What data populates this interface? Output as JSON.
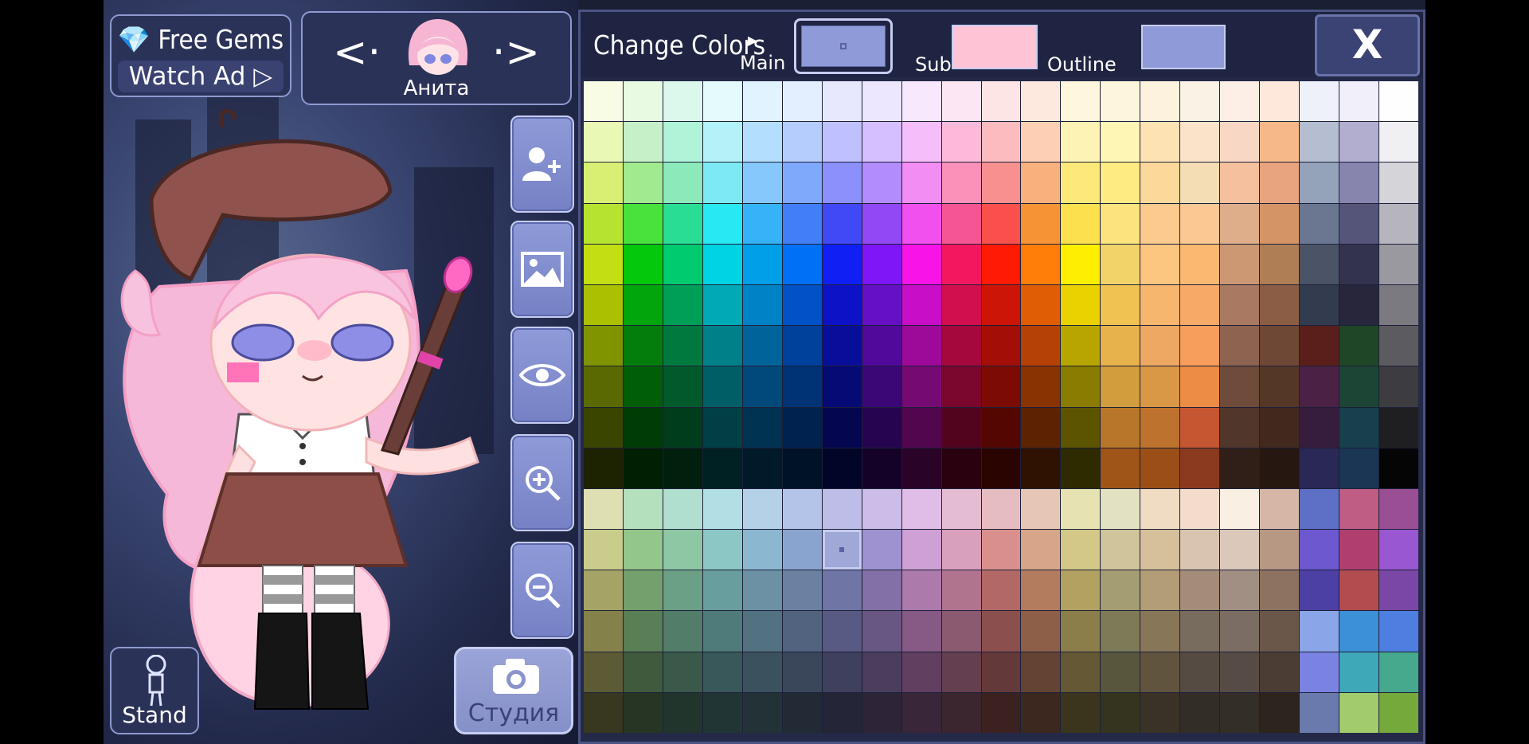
{
  "gems": {
    "line1": "Free Gems",
    "line2": "Watch Ad"
  },
  "character": {
    "name": "Анита"
  },
  "stand": {
    "label": "Stand"
  },
  "studio": {
    "label": "Студия"
  },
  "panel": {
    "title": "Change Colors",
    "main_label": "Main",
    "sub_label": "Sub",
    "outline_label": "Outline",
    "close_label": "X",
    "main_color": "#8f9bd8",
    "sub_color": "#ffc3d6",
    "outline_color": "#8f9bd8"
  },
  "palette": {
    "selected": [
      11,
      6
    ],
    "rows": [
      [
        "#f8fce5",
        "#e8fae2",
        "#dcf8ec",
        "#e5fafc",
        "#e1f3fe",
        "#e3eefe",
        "#e7e8fe",
        "#ece7fe",
        "#f7e8fd",
        "#fde6f3",
        "#fde5e6",
        "#fde9dd",
        "#fef7dd",
        "#fdf6dd",
        "#fdf2dd",
        "#fbf2e6",
        "#fdefe6",
        "#fde8db",
        "#eef0fa",
        "#f1f0fa",
        "#fefefe"
      ],
      [
        "#eaf8b5",
        "#c6f0c7",
        "#aff3d8",
        "#b2f2f8",
        "#b4defd",
        "#b5cdfd",
        "#bfc1fe",
        "#d6bffe",
        "#f5befa",
        "#fcbad8",
        "#fcbcbf",
        "#fdcfb4",
        "#fdf3b5",
        "#fef6b5",
        "#fde3b4",
        "#fbe3c9",
        "#f8d7c4",
        "#f6b888",
        "#b5bdd0",
        "#b1aed0",
        "#f0eff2"
      ],
      [
        "#d9ef74",
        "#a2ea8f",
        "#8ce9ba",
        "#7ce9f4",
        "#86c8fb",
        "#7fa9fb",
        "#8c90fc",
        "#b38cfc",
        "#f28ef3",
        "#f991b9",
        "#f8908f",
        "#f8b07d",
        "#fde97a",
        "#feeb82",
        "#fdd89b",
        "#f4dcb5",
        "#f4c09d",
        "#e7a47e",
        "#94a2ba",
        "#8785ae",
        "#d5d4d9"
      ],
      [
        "#b6e32f",
        "#49e13b",
        "#29de94",
        "#28e8f4",
        "#36b3f8",
        "#417ff8",
        "#4148f6",
        "#9149f6",
        "#f250ee",
        "#f55592",
        "#f9504d",
        "#f69335",
        "#fde04e",
        "#fde37d",
        "#fcc98e",
        "#fbc893",
        "#deae8b",
        "#d59466",
        "#6b7791",
        "#555479",
        "#b6b5bd"
      ],
      [
        "#c3de12",
        "#03c80c",
        "#00cc6f",
        "#00d3e3",
        "#009fe8",
        "#0071f5",
        "#1020f5",
        "#7e16f5",
        "#f813e6",
        "#f2185f",
        "#ff1a04",
        "#ff7d08",
        "#feef00",
        "#f1d36a",
        "#fcc580",
        "#fbb871",
        "#cc9873",
        "#b07e55",
        "#4b5466",
        "#34334f",
        "#9a999f"
      ],
      [
        "#aac000",
        "#03a50c",
        "#009f57",
        "#00a9b6",
        "#0083c6",
        "#0052c6",
        "#0d12c6",
        "#6610c6",
        "#c80ec6",
        "#d10e4e",
        "#cc1507",
        "#e05d05",
        "#ead200",
        "#f0c251",
        "#f6b66e",
        "#f7a967",
        "#a97962",
        "#8c5d45",
        "#333b4e",
        "#27263b",
        "#7b7a80"
      ],
      [
        "#809400",
        "#047d0c",
        "#00793f",
        "#008089",
        "#00649a",
        "#00419c",
        "#080e9a",
        "#50099b",
        "#9d0a9a",
        "#a4083d",
        "#a30f06",
        "#b64104",
        "#b8a600",
        "#e7b14c",
        "#eda963",
        "#f79e5c",
        "#8e6450",
        "#6e4835",
        "#5a1f1b",
        "#1f4626",
        "#5c5b60"
      ],
      [
        "#5a6a00",
        "#005e09",
        "#005a2b",
        "#005e66",
        "#00497a",
        "#003276",
        "#060a75",
        "#3b0776",
        "#760a73",
        "#7b062e",
        "#7c0b04",
        "#8a3302",
        "#8a7c00",
        "#d19d3d",
        "#d99846",
        "#ed8c44",
        "#6e4b3b",
        "#553728",
        "#4b2245",
        "#1c4535",
        "#3d3c40"
      ],
      [
        "#3a4500",
        "#003c06",
        "#003d1c",
        "#003f44",
        "#003251",
        "#00224f",
        "#04074f",
        "#27044f",
        "#51064e",
        "#52041f",
        "#540702",
        "#5c2302",
        "#5d5400",
        "#b8762a",
        "#bd722d",
        "#c45731",
        "#51362b",
        "#41291d",
        "#371d3d",
        "#173f4d",
        "#1f1e21"
      ],
      [
        "#1d2300",
        "#001f03",
        "#001f0d",
        "#002123",
        "#001a2a",
        "#001228",
        "#020428",
        "#140228",
        "#290328",
        "#2a020f",
        "#2a0401",
        "#2f1201",
        "#2f2b00",
        "#9f5418",
        "#9b4f17",
        "#8b3a1f",
        "#2f1f18",
        "#261810",
        "#2a2856",
        "#1b3554",
        "#050506"
      ],
      [
        "#dedfb2",
        "#b5e0bd",
        "#b0decf",
        "#b2dfe4",
        "#b4d1e7",
        "#b4c4e8",
        "#bdbde8",
        "#ccbce8",
        "#e0bde6",
        "#e5bdd2",
        "#e5bcbf",
        "#e6c6b4",
        "#e6e2b2",
        "#e2e2c2",
        "#efdcc2",
        "#f3dccb",
        "#f9efe3",
        "#d6b7a7",
        "#5e6fc6",
        "#bf5d85",
        "#9a4e93"
      ],
      [
        "#c9cc8a",
        "#93c68a",
        "#8ec7a4",
        "#8cc7c6",
        "#8bb8d0",
        "#89a5cf",
        "#9fa8d6",
        "#9e92d0",
        "#cfa0d5",
        "#d9a0bb",
        "#d9908d",
        "#d7a589",
        "#d3c887",
        "#cfc49b",
        "#d5c09b",
        "#d9c4b0",
        "#dcc7bb",
        "#b79883",
        "#6e58d0",
        "#b13f6e",
        "#9957d2"
      ],
      [
        "#a6a366",
        "#73a06c",
        "#6b9f86",
        "#699e9e",
        "#6d91a4",
        "#6a81a2",
        "#6f76a6",
        "#8370a6",
        "#ad7aac",
        "#b1748e",
        "#b26965",
        "#b37c5f",
        "#b3a161",
        "#a49c72",
        "#b29d77",
        "#a48c7a",
        "#a28f83",
        "#8e7260",
        "#4c40a5",
        "#b24c4e",
        "#7a47a6"
      ],
      [
        "#84814a",
        "#5a7e55",
        "#527d69",
        "#4f7b7b",
        "#527181",
        "#51637e",
        "#595a84",
        "#685683",
        "#875a86",
        "#8a5a70",
        "#8b504e",
        "#8d5f49",
        "#8c7e4a",
        "#7d7b57",
        "#887659",
        "#786c5e",
        "#7b6d63",
        "#6b5749",
        "#8ba6e8",
        "#3c90d8",
        "#4e7fe0"
      ],
      [
        "#5d5b35",
        "#3f5a3d",
        "#3a594b",
        "#395859",
        "#3b525e",
        "#3a475b",
        "#3f3f5e",
        "#4b3d5d",
        "#613f60",
        "#633f4f",
        "#633a39",
        "#654334",
        "#645934",
        "#58573e",
        "#61543f",
        "#554b43",
        "#574c45",
        "#4b3d33",
        "#7b83e2",
        "#3fa8b8",
        "#46a88c"
      ],
      [
        "#38371f",
        "#263524",
        "#22352c",
        "#223535",
        "#233237",
        "#222a36",
        "#252538",
        "#2d2437",
        "#3a2639",
        "#3b252f",
        "#3b2221",
        "#3c281e",
        "#3c351e",
        "#35341f",
        "#3a3226",
        "#332d28",
        "#342e29",
        "#2d241e",
        "#6a7aad",
        "#a1cc6c",
        "#76a93b"
      ]
    ]
  }
}
